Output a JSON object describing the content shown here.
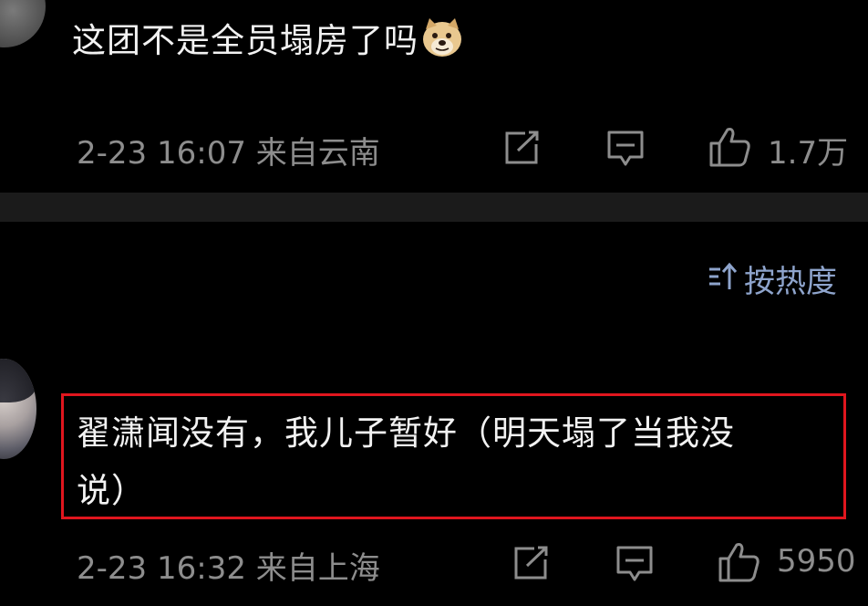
{
  "comments": [
    {
      "text": "这团不是全员塌房了吗",
      "emoji_icon": "doge-icon",
      "meta": "2-23 16:07 来自云南",
      "like_count": "1.7万"
    },
    {
      "text_line1": "翟潇闻没有，我儿子暂好（明天塌了当我没",
      "text_line2": "说）",
      "meta": "2-23 16:32 来自上海",
      "like_count": "5950"
    }
  ],
  "sort": {
    "label": "按热度",
    "icon": "sort-icon"
  },
  "colors": {
    "background": "#000000",
    "text": "#f2f2f2",
    "meta": "#8d8d8d",
    "sort_accent": "#8ea4cc",
    "highlight": "#e0161e",
    "divider": "#1b1b1b"
  }
}
